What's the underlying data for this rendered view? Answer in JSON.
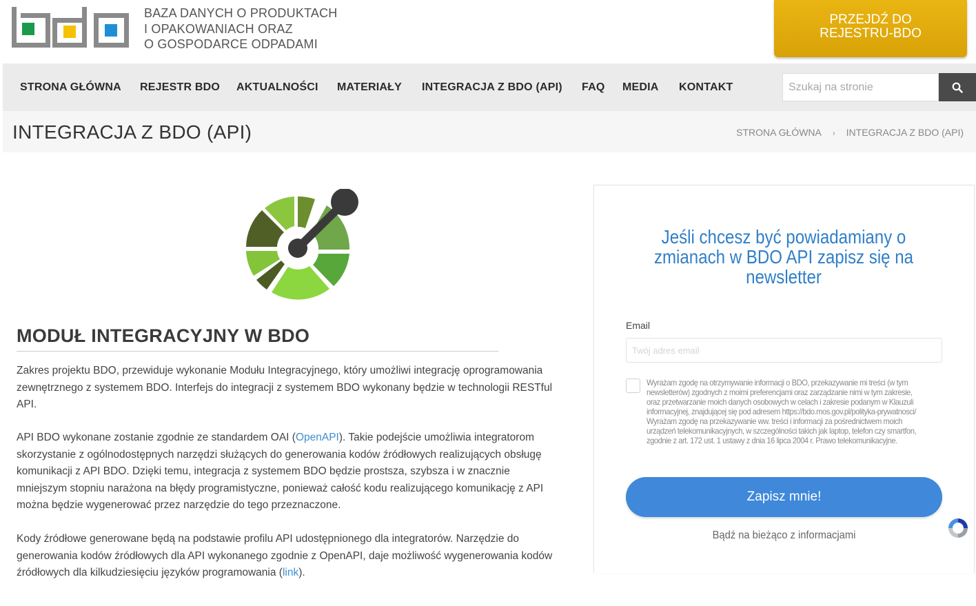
{
  "header": {
    "logo_alt_lines": [
      "BAZA DANYCH O PRODUKTACH",
      "I OPAKOWANIACH ORAZ",
      "O GOSPODARCE ODPADAMI"
    ],
    "cta_line1": "PRZEJDŹ DO",
    "cta_line2": "REJESTRU-BDO"
  },
  "colors": {
    "logo_green": "#1a9a4a",
    "logo_yellow": "#f4c200",
    "logo_blue": "#1e8fd6",
    "cta": "#e0ab0d",
    "accent_blue": "#3f88da"
  },
  "nav": {
    "items": [
      {
        "label": "STRONA GŁÓWNA"
      },
      {
        "label": "REJESTR BDO"
      },
      {
        "label": "AKTUALNOŚCI"
      },
      {
        "label": "MATERIAŁY"
      },
      {
        "label": "INTEGRACJA Z BDO (API)"
      },
      {
        "label": "FAQ"
      },
      {
        "label": "MEDIA"
      },
      {
        "label": "KONTAKT"
      }
    ],
    "search_placeholder": "Szukaj na stronie",
    "search_icon": "search-icon"
  },
  "titlebar": {
    "title": "INTEGRACJA Z BDO (API)",
    "breadcrumb": [
      "STRONA GŁÓWNA",
      "INTEGRACJA Z BDO (API)"
    ],
    "separator": "›"
  },
  "content": {
    "section_title": "MODUŁ INTEGRACYJNY W BDO",
    "p1": "Zakres projektu BDO, przewiduje wykonanie Modułu Integracyjnego, który umożliwi integrację oprogramowania zewnętrznego z systemem BDO. Interfejs do integracji z systemem BDO wykonany będzie w technologii RESTful API.",
    "p2_before": "API BDO wykonane zostanie zgodnie ze standardem OAI (",
    "p2_link": "OpenAPI",
    "p2_after": "). Takie podejście umożliwia integratorom skorzystanie z ogólnodostępnych narzędzi służących do generowania kodów źródłowych realizujących obsługę komunikacji z API BDO. Dzięki temu, integracja z systemem BDO będzie prostsza, szybsza i w znacznie mniejszym stopniu narażona na błędy programistyczne, ponieważ całość kodu realizującego komunikację z API można będzie wygenerować przez narzędzie do tego przeznaczone.",
    "p3_before": "Kody źródłowe generowane będą na podstawie profilu API udostępnionego dla integratorów. Narzędzie do generowania kodów źródłowych dla API wykonanego zgodnie z OpenAPI, daje możliwość wygenerowania kodów źródłowych dla kilkudziesięciu języków programowania (",
    "p3_link": "link",
    "p3_after": ")."
  },
  "newsletter": {
    "heading": "Jeśli chcesz być powiadamiany o zmianach w BDO API zapisz się na newsletter",
    "email_label": "Email",
    "email_placeholder": "Twój adres email",
    "consent_1": "Wyrażam zgodę na otrzymywanie informacji o BDO, przekazywanie mi treści (w tym newsletterów) zgodnych z moimi preferencjami oraz zarządzanie nimi w tym zakresie, oraz przetwarzanie moich danych osobowych w celach i zakresie podanym w Klauzuli informacyjnej, znajdującej się pod adresem https://bdo.mos.gov.pl/polityka-prywatnosci/",
    "consent_2": "Wyrażam zgodę na przekazywanie ww. treści i informacji za pośrednictwem moich urządzeń telekomunikacyjnych, w szczególności takich jak laptop, telefon czy smartfon, zgodnie z art. 172 ust. 1 ustawy z dnia 16 lipca 2004 r. Prawo telekomunikacyjne.",
    "submit_label": "Zapisz mnie!",
    "footer": "Bądź na bieżąco z informacjami"
  }
}
